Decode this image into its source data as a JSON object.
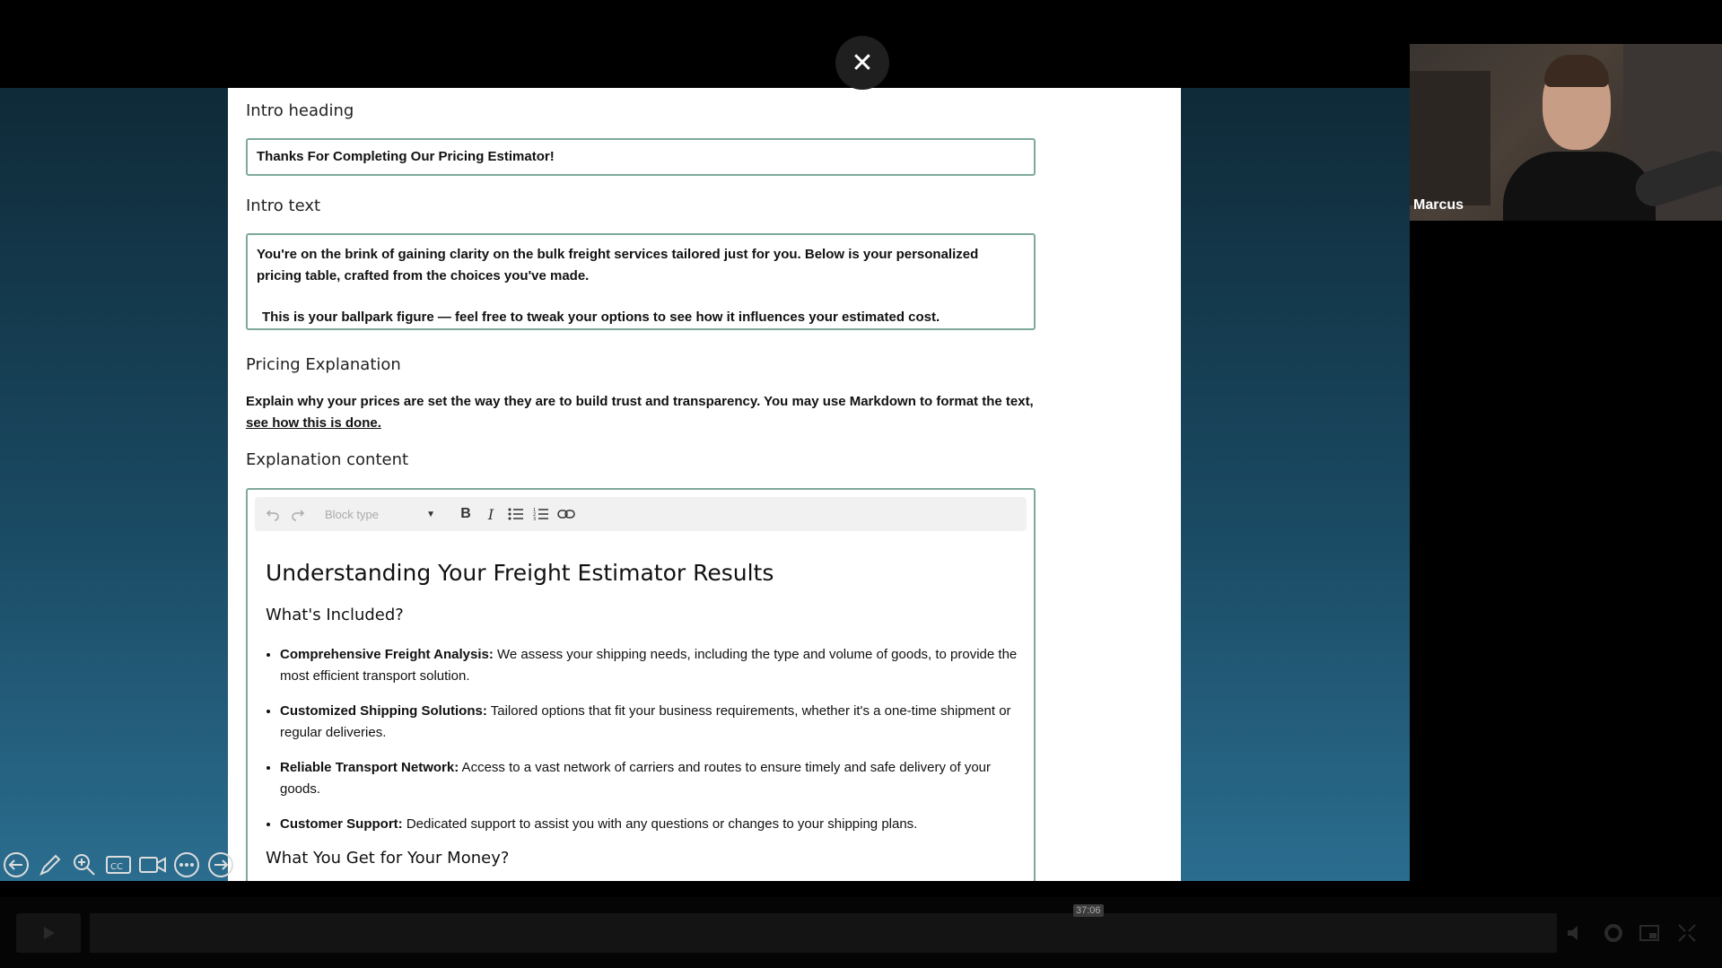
{
  "form": {
    "intro_heading_label": "Intro heading",
    "intro_heading_value": "Thanks For Completing Our Pricing Estimator!",
    "intro_text_label": "Intro text",
    "intro_text_p1": "You're on the brink of gaining clarity on the bulk freight services tailored just for you. Below is your personalized pricing table, crafted from the choices you've made.",
    "intro_text_p2": "This is your ballpark figure — feel free to tweak your options to see how it influences your estimated cost.",
    "pricing_explanation_label": "Pricing Explanation",
    "pricing_explanation_desc": "Explain why your prices are set the way they are to build trust and transparency. You may use Markdown to format the text, ",
    "pricing_explanation_link": "see how this is done.",
    "explanation_content_label": "Explanation content"
  },
  "toolbar": {
    "block_type_placeholder": "Block type",
    "buttons": [
      "undo",
      "redo",
      "bold",
      "italic",
      "bulleted-list",
      "numbered-list",
      "link"
    ]
  },
  "editor": {
    "h1": "Understanding Your Freight Estimator Results",
    "h2_included": "What's Included?",
    "items": [
      {
        "title": "Comprehensive Freight Analysis:",
        "text": " We assess your shipping needs, including the type and volume of goods, to provide the most efficient transport solution."
      },
      {
        "title": "Customized Shipping Solutions:",
        "text": " Tailored options that fit your business requirements, whether it's a one-time shipment or regular deliveries."
      },
      {
        "title": "Reliable Transport Network:",
        "text": " Access to a vast network of carriers and routes to ensure timely and safe delivery of your goods."
      },
      {
        "title": "Customer Support:",
        "text": " Dedicated support to assist you with any questions or changes to your shipping plans."
      }
    ],
    "h2_money": "What You Get for Your Money?"
  },
  "webcam": {
    "participant_name": "Marcus"
  },
  "player": {
    "timestamp": "37:06"
  },
  "colors": {
    "field_border": "#7fa99d",
    "stage_bg": "#1a4a63"
  }
}
